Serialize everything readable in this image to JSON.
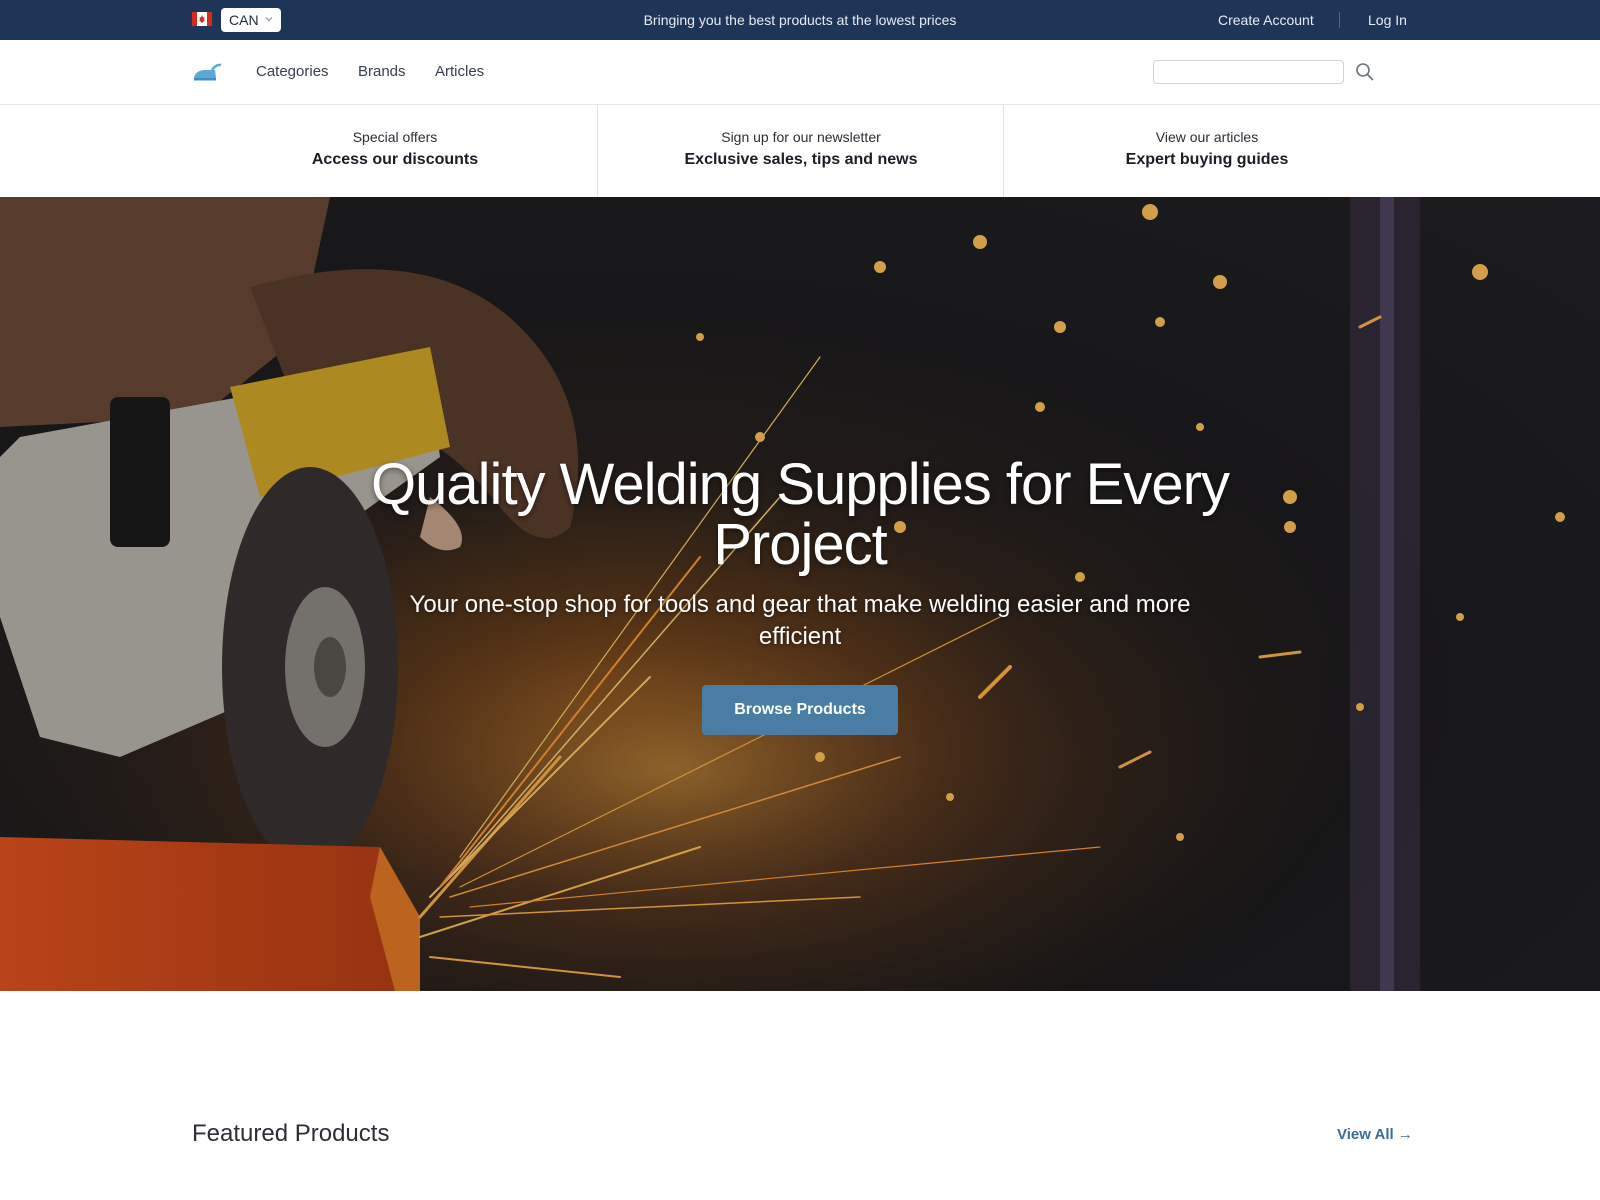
{
  "topbar": {
    "country": "CAN",
    "tagline": "Bringing you the best products at the lowest prices",
    "create_account": "Create Account",
    "log_in": "Log In",
    "flag_icon": "canada-flag-icon",
    "colors": {
      "background": "#1e3557"
    }
  },
  "nav": {
    "logo_icon": "iron-logo-icon",
    "links": [
      "Categories",
      "Brands",
      "Articles"
    ],
    "search_placeholder": "",
    "search_icon": "search-icon"
  },
  "promos": [
    {
      "small": "Special offers",
      "big": "Access our discounts"
    },
    {
      "small": "Sign up for our newsletter",
      "big": "Exclusive sales, tips and news"
    },
    {
      "small": "View our articles",
      "big": "Expert buying guides"
    }
  ],
  "hero": {
    "title": "Quality Welding Supplies for Every Project",
    "subtitle": "Your one-stop shop for tools and gear that make welding easier and more efficient",
    "cta_label": "Browse Products",
    "cta_color": "#4a7da4"
  },
  "featured": {
    "title": "Featured Products",
    "view_all": "View All →",
    "link_color": "#3c6d98"
  }
}
